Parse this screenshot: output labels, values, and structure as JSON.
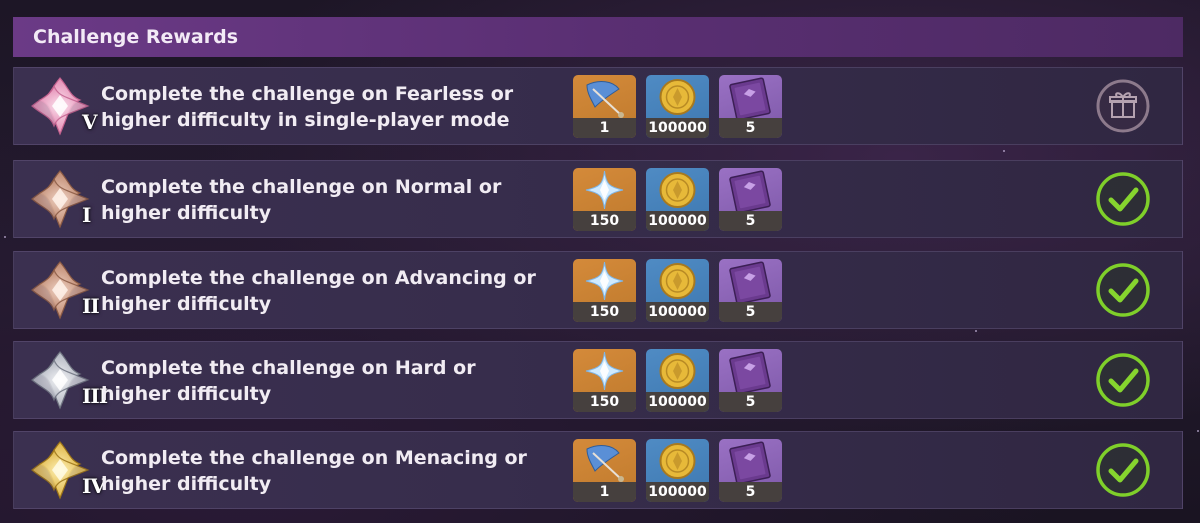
{
  "header": {
    "title": "Challenge Rewards"
  },
  "colors": {
    "complete_ring": "#7fcf2a",
    "claimable_ring": "#8d7a8c",
    "header_bg": "#6b3a86",
    "row_bg": "#372d4c"
  },
  "rows": [
    {
      "emblem_icon": "pink-flower-emblem-icon",
      "emblem_color": "#e98bb4",
      "roman": "V",
      "description_line1": "Complete the challenge on Fearless or",
      "description_line2": "higher difficulty in single-player mode",
      "status": "gift-icon",
      "rewards": [
        {
          "icon": "quill-feather-icon",
          "qty": "1"
        },
        {
          "icon": "mora-coin-icon",
          "qty": "100000"
        },
        {
          "icon": "hero-wit-book-icon",
          "qty": "5"
        }
      ]
    },
    {
      "emblem_icon": "bronze-flower-emblem-icon",
      "emblem_color": "#c08a70",
      "roman": "I",
      "description_line1": "Complete the challenge on Normal or",
      "description_line2": "higher difficulty",
      "status": "check-icon",
      "rewards": [
        {
          "icon": "primogem-icon",
          "qty": "150"
        },
        {
          "icon": "mora-coin-icon",
          "qty": "100000"
        },
        {
          "icon": "hero-wit-book-icon",
          "qty": "5"
        }
      ]
    },
    {
      "emblem_icon": "bronze-flower-emblem-icon",
      "emblem_color": "#c08a70",
      "roman": "II",
      "description_line1": "Complete the challenge on Advancing or",
      "description_line2": "higher difficulty",
      "status": "check-icon",
      "rewards": [
        {
          "icon": "primogem-icon",
          "qty": "150"
        },
        {
          "icon": "mora-coin-icon",
          "qty": "100000"
        },
        {
          "icon": "hero-wit-book-icon",
          "qty": "5"
        }
      ]
    },
    {
      "emblem_icon": "silver-flower-emblem-icon",
      "emblem_color": "#b8bcc6",
      "roman": "III",
      "description_line1": "Complete the challenge on Hard or",
      "description_line2": "higher difficulty",
      "status": "check-icon",
      "rewards": [
        {
          "icon": "primogem-icon",
          "qty": "150"
        },
        {
          "icon": "mora-coin-icon",
          "qty": "100000"
        },
        {
          "icon": "hero-wit-book-icon",
          "qty": "5"
        }
      ]
    },
    {
      "emblem_icon": "gold-flower-emblem-icon",
      "emblem_color": "#e6c04a",
      "roman": "IV",
      "description_line1": "Complete the challenge on Menacing or",
      "description_line2": "higher difficulty",
      "status": "check-icon",
      "rewards": [
        {
          "icon": "quill-feather-icon",
          "qty": "1"
        },
        {
          "icon": "mora-coin-icon",
          "qty": "100000"
        },
        {
          "icon": "hero-wit-book-icon",
          "qty": "5"
        }
      ]
    }
  ]
}
